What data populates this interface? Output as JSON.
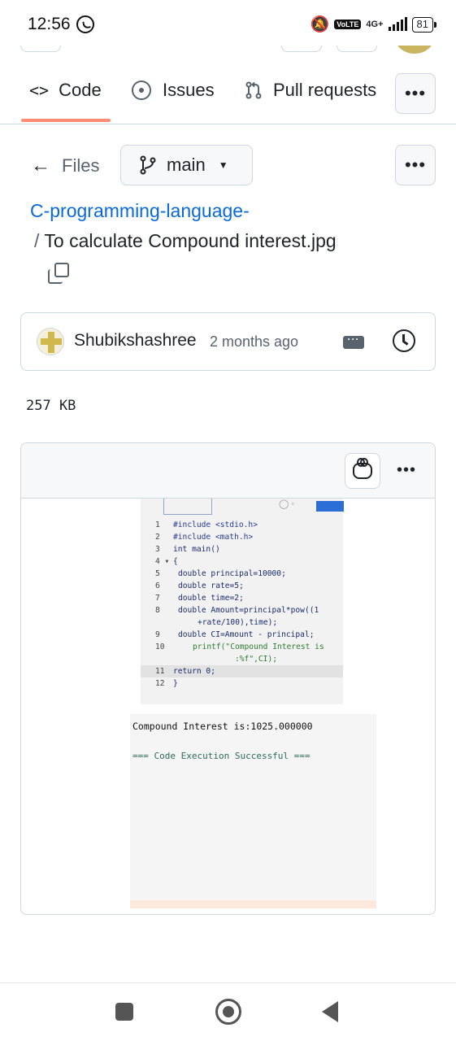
{
  "status_bar": {
    "time": "12:56",
    "network": "4G+",
    "volte": "Vo LTE",
    "battery": "81"
  },
  "tabs": {
    "code_label": "Code",
    "issues_label": "Issues",
    "pulls_label": "Pull requests",
    "active": "Code"
  },
  "nav": {
    "files_label": "Files",
    "branch": "main"
  },
  "file": {
    "repo": "C-programming-language-",
    "path_separator": "/",
    "name": "To calculate Compound interest.jpg",
    "size": "257 KB"
  },
  "commit": {
    "author": "Shubikshashree",
    "time_ago": "2 months ago"
  },
  "embedded_image": {
    "code_lines": [
      {
        "n": "1",
        "text": "#include <stdio.h>"
      },
      {
        "n": "2",
        "text": "#include <math.h>"
      },
      {
        "n": "3",
        "text": "int main()"
      },
      {
        "n": "4 ▾",
        "text": "{"
      },
      {
        "n": "5",
        "text": "double principal=10000;"
      },
      {
        "n": "6",
        "text": "double rate=5;"
      },
      {
        "n": "7",
        "text": "double time=2;"
      },
      {
        "n": "8",
        "text": "double Amount=principal*pow((1"
      },
      {
        "n": "",
        "text": "+rate/100),time);"
      },
      {
        "n": "9",
        "text": "double CI=Amount - principal;"
      },
      {
        "n": "10",
        "text": "printf(\"Compound Interest is"
      },
      {
        "n": "",
        "text": ":%f\",CI);"
      },
      {
        "n": "11",
        "text": "return 0;"
      },
      {
        "n": "12",
        "text": "}"
      }
    ],
    "output_line": "Compound Interest is:1025.000000",
    "status_line": "=== Code Execution Successful ==="
  },
  "colors": {
    "link": "#0969da",
    "tab_underline": "#fd8c73",
    "border": "#d0d7de"
  },
  "icons": [
    "code-icon",
    "issue-icon",
    "pull-request-icon",
    "kebab-icon",
    "arrow-left-icon",
    "git-branch-icon",
    "caret-down-icon",
    "copy-icon",
    "history-icon",
    "copilot-icon"
  ]
}
